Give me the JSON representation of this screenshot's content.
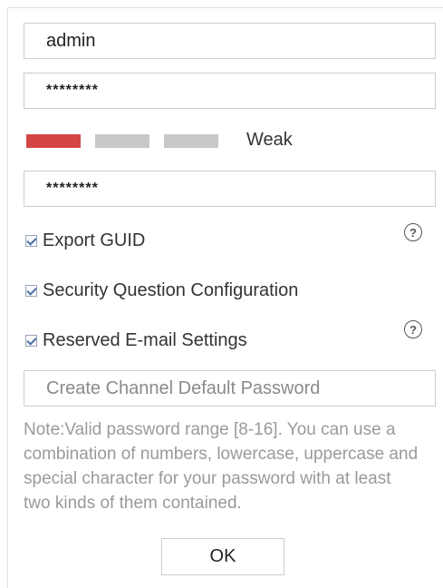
{
  "form": {
    "username_value": "admin",
    "password_value": "********",
    "confirm_password_value": "********",
    "strength": {
      "label": "Weak",
      "colors": [
        "#d64545",
        "#c8c8c8",
        "#c8c8c8"
      ]
    },
    "checkboxes": [
      {
        "label": "Export GUID",
        "checked": true
      },
      {
        "label": "Security Question Configuration",
        "checked": true
      },
      {
        "label": "Reserved E-mail Settings",
        "checked": true
      }
    ],
    "help_icon_glyph": "?",
    "channel_password_placeholder": "Create Channel Default Password",
    "note": "Note:Valid password range [8-16]. You can use a combination of numbers, lowercase, uppercase and special character for your password with at least two kinds of them contained.",
    "ok_label": "OK"
  }
}
